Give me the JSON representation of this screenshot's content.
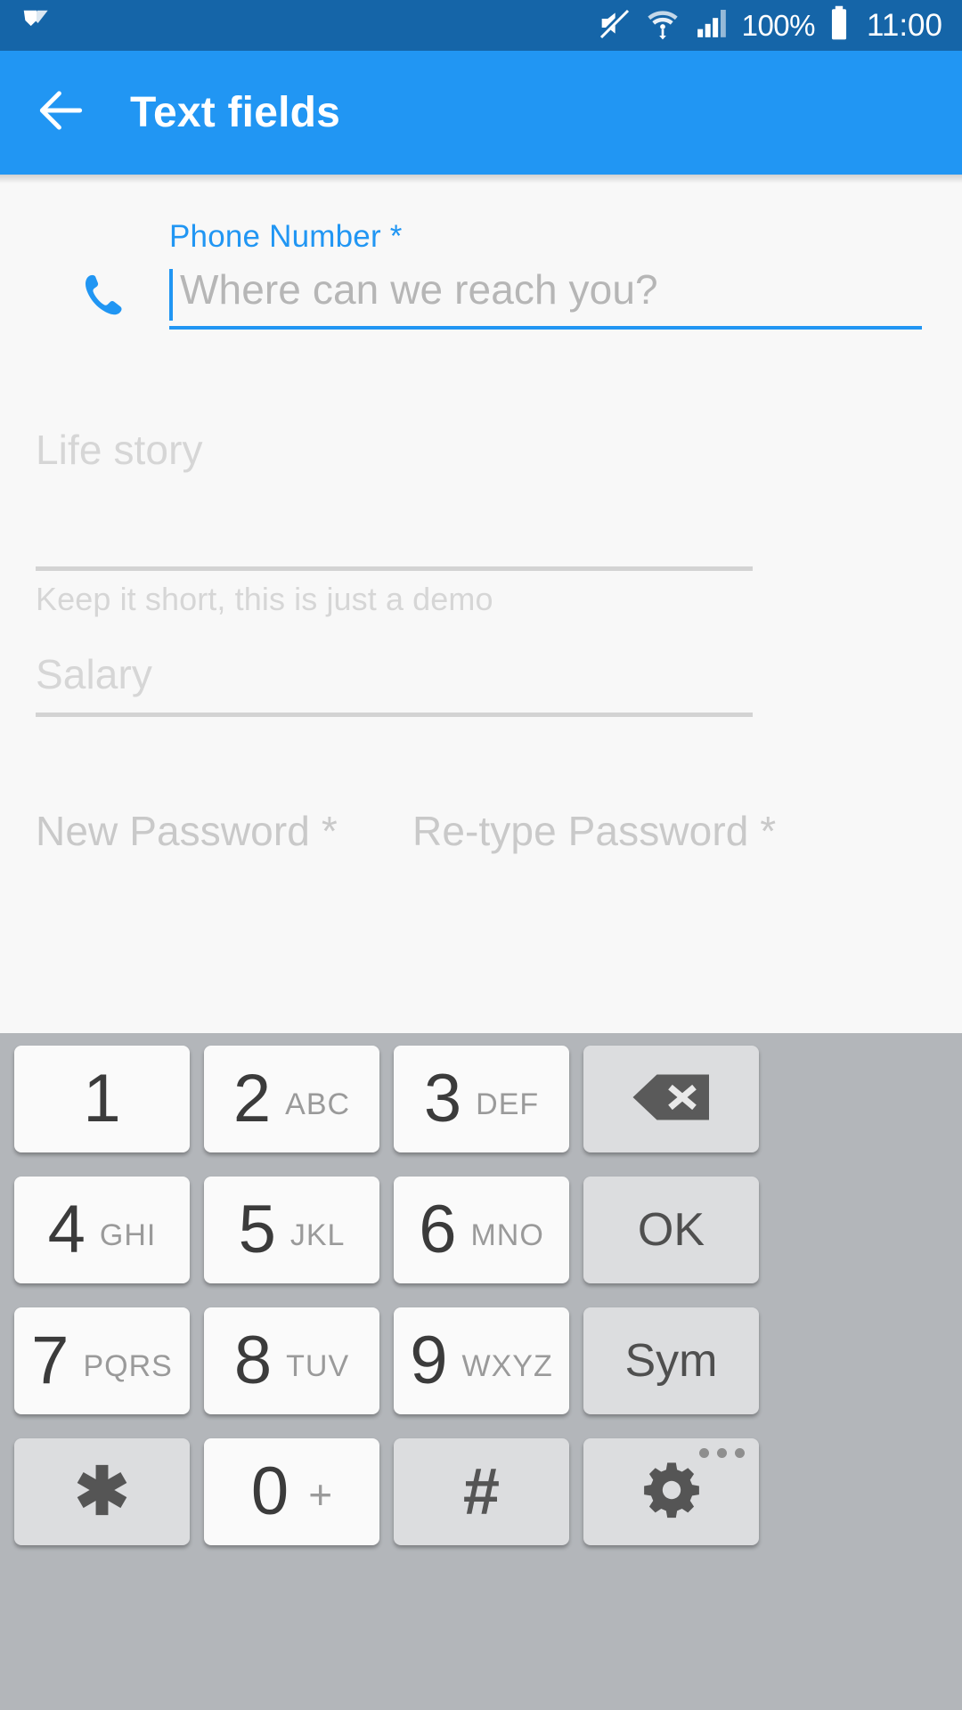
{
  "status_bar": {
    "background": "#1565a8",
    "app_icon": "app-notification-icon",
    "icons": [
      "mute-icon",
      "wifi-icon",
      "cellular-signal-icon",
      "battery-icon"
    ],
    "battery_percent": "100%",
    "clock": "11:00"
  },
  "app_bar": {
    "background": "#2196f3",
    "back_icon": "back-arrow-icon",
    "title": "Text fields"
  },
  "form": {
    "phone": {
      "label": "Phone Number *",
      "placeholder": "Where can we reach you?",
      "value": "",
      "icon": "phone-icon",
      "accent_color": "#2196f3",
      "focused": true
    },
    "life_story": {
      "hint": "Life story",
      "value": "",
      "helper": "Keep it short, this is just a demo"
    },
    "salary": {
      "hint": "Salary",
      "value": ""
    },
    "new_password": {
      "hint": "New Password *",
      "value": ""
    },
    "retype_password": {
      "hint": "Re-type Password *",
      "value": ""
    }
  },
  "keyboard": {
    "type": "numeric-phone-keypad",
    "background": "#b3b6ba",
    "rows": [
      [
        {
          "name": "key-1",
          "digit": "1",
          "letters": "",
          "style": "white"
        },
        {
          "name": "key-2",
          "digit": "2",
          "letters": "ABC",
          "style": "white"
        },
        {
          "name": "key-3",
          "digit": "3",
          "letters": "DEF",
          "style": "white"
        },
        {
          "name": "key-backspace",
          "icon": "backspace-icon",
          "style": "gray"
        }
      ],
      [
        {
          "name": "key-4",
          "digit": "4",
          "letters": "GHI",
          "style": "white"
        },
        {
          "name": "key-5",
          "digit": "5",
          "letters": "JKL",
          "style": "white"
        },
        {
          "name": "key-6",
          "digit": "6",
          "letters": "MNO",
          "style": "white"
        },
        {
          "name": "key-ok",
          "word": "OK",
          "style": "gray"
        }
      ],
      [
        {
          "name": "key-7",
          "digit": "7",
          "letters": "PQRS",
          "style": "white"
        },
        {
          "name": "key-8",
          "digit": "8",
          "letters": "TUV",
          "style": "white"
        },
        {
          "name": "key-9",
          "digit": "9",
          "letters": "WXYZ",
          "style": "white"
        },
        {
          "name": "key-sym",
          "word": "Sym",
          "style": "gray"
        }
      ],
      [
        {
          "name": "key-asterisk",
          "symbol": "✱",
          "style": "gray"
        },
        {
          "name": "key-0",
          "digit": "0",
          "plus": "+",
          "style": "white"
        },
        {
          "name": "key-hash",
          "symbol": "#",
          "style": "gray"
        },
        {
          "name": "key-settings",
          "icon": "gear-icon",
          "overflow": "more-dots-icon",
          "style": "gray"
        }
      ]
    ],
    "labels": {
      "k1_digit": "1",
      "k2_digit": "2",
      "k2_letters": "ABC",
      "k3_digit": "3",
      "k3_letters": "DEF",
      "k4_digit": "4",
      "k4_letters": "GHI",
      "k5_digit": "5",
      "k5_letters": "JKL",
      "k6_digit": "6",
      "k6_letters": "MNO",
      "k7_digit": "7",
      "k7_letters": "PQRS",
      "k8_digit": "8",
      "k8_letters": "TUV",
      "k9_digit": "9",
      "k9_letters": "WXYZ",
      "k0_digit": "0",
      "k0_plus": "+",
      "ok": "OK",
      "sym": "Sym",
      "asterisk": "✱",
      "hash": "#"
    }
  }
}
